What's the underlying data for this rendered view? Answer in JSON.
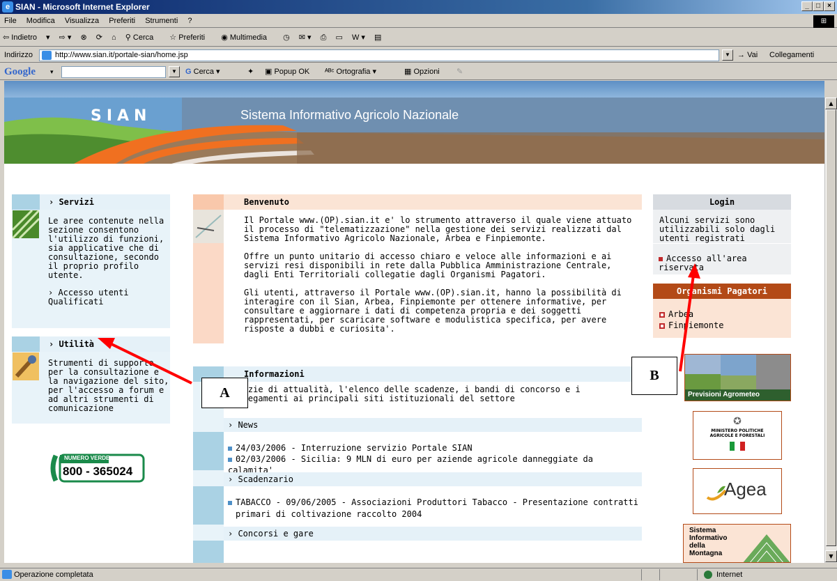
{
  "window": {
    "title": "SIAN - Microsoft Internet Explorer"
  },
  "menu": [
    "File",
    "Modifica",
    "Visualizza",
    "Preferiti",
    "Strumenti",
    "?"
  ],
  "toolbar": {
    "back": "Indietro",
    "search": "Cerca",
    "favorites": "Preferiti",
    "media": "Multimedia"
  },
  "address": {
    "label": "Indirizzo",
    "url": "http://www.sian.it/portale-sian/home.jsp",
    "go": "Vai",
    "links": "Collegamenti"
  },
  "googlebar": {
    "logo": "Google",
    "search": "Cerca",
    "popup": "Popup OK",
    "spell": "Ortografia",
    "options": "Opzioni"
  },
  "banner": {
    "brand": "SIAN",
    "subtitle": "Sistema Informativo Agricolo Nazionale"
  },
  "left": {
    "servizi": {
      "title": "Servizi",
      "text": "Le aree contenute nella sezione consentono l'utilizzo di funzioni, sia applicative che di consultazione, secondo il proprio profilo utente.",
      "link": "Accesso utenti Qualificati"
    },
    "utilita": {
      "title": "Utilità",
      "text": "Strumenti di supporto per la consultazione e la navigazione del sito, per l'accesso a forum e ad altri strumenti di comunicazione"
    },
    "numero": {
      "label": "NUMERO VERDE",
      "number": "800 - 365024"
    }
  },
  "center": {
    "benvenuto": {
      "title": "Benvenuto",
      "p1": "Il Portale www.(OP).sian.it e' lo strumento attraverso il quale viene attuato il processo di \"telematizzazione\" nella gestione dei servizi realizzati dal Sistema Informativo Agricolo Nazionale, Arbea e Finpiemonte.",
      "p2": "Offre un punto unitario di accesso chiaro e veloce alle informazioni e ai servizi resi disponibili in rete dalla Pubblica Amministrazione Centrale, dagli Enti Territoriali collegatie dagli Organismi Pagatori.",
      "p3": "Gli utenti, attraverso il Portale www.(OP).sian.it, hanno la possibilità di interagire con il Sian, Arbea, Finpiemonte per ottenere informative, per consultare e aggiornare i dati di competenza propria e dei soggetti rappresentati, per scaricare software e modulistica specifica, per avere risposte a dubbi e curiosita'."
    },
    "informazioni": {
      "title": "Informazioni",
      "text": "Notizie di attualità, l'elenco delle scadenze, i bandi di concorso e i collegamenti ai principali siti istituzionali del settore"
    },
    "news": {
      "title": "News",
      "items": [
        "24/03/2006 - Interruzione servizio Portale SIAN",
        "02/03/2006 - Sicilia: 9 MLN di euro per aziende agricole danneggiate da calamita'"
      ]
    },
    "scadenzario": {
      "title": "Scadenzario",
      "items": [
        "TABACCO - 09/06/2005 - Associazioni Produttori Tabacco - Presentazione contratti primari di coltivazione raccolto 2004"
      ]
    },
    "concorsi": {
      "title": "Concorsi e gare"
    }
  },
  "right": {
    "login": {
      "title": "Login",
      "text": "Alcuni servizi sono utilizzabili solo dagli utenti registrati",
      "link": "Accesso all'area riservata"
    },
    "organismi": {
      "title": "Organismi Pagatori",
      "items": [
        "Arbea",
        "Finpiemonte"
      ]
    },
    "previsioni": "Previsioni Agrometeo",
    "ministero": "MINISTERO POLITICHE AGRICOLE E FORESTALI",
    "agea": "Agea",
    "montagna": "Sistema Informativo della Montagna"
  },
  "annotations": {
    "a": "A",
    "b": "B"
  },
  "status": {
    "text": "Operazione completata",
    "zone": "Internet"
  },
  "colors": {
    "titlebar": "#0a246a",
    "arrow": "#ff0000",
    "headbar": "#e5f1f8",
    "salmon": "#f9d3bd",
    "orange_head": "#b34a17"
  }
}
